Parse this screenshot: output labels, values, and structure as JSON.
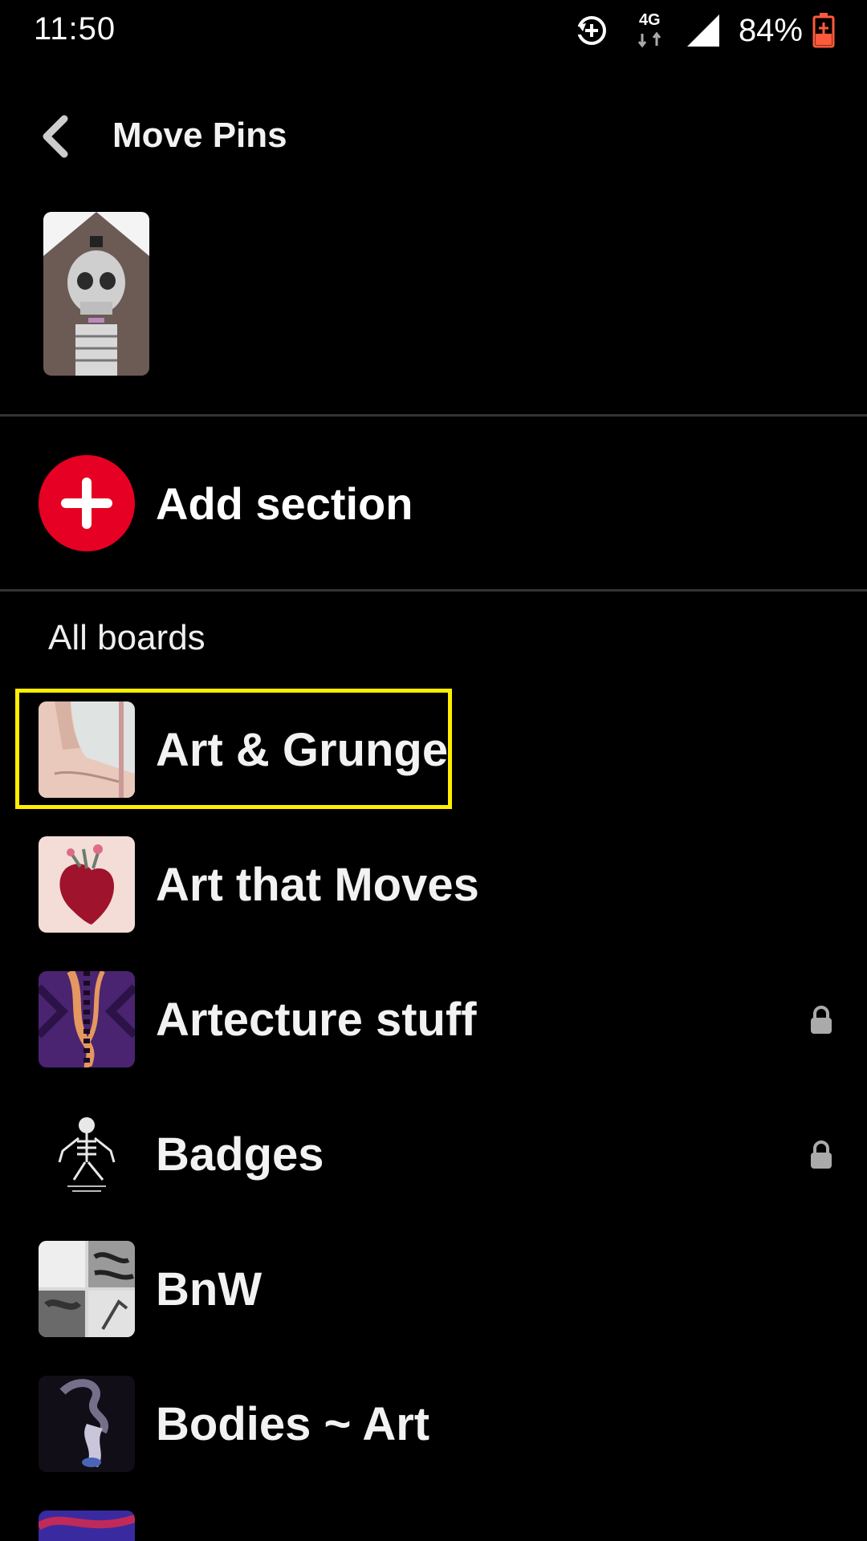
{
  "status_bar": {
    "time": "11:50",
    "network_label": "4G",
    "battery_percent": "84%",
    "icons": [
      "sync-icon",
      "network-4g-icon",
      "signal-icon",
      "battery-charging-icon"
    ]
  },
  "header": {
    "title": "Move Pins",
    "back_icon": "chevron-left-icon"
  },
  "pin": {
    "thumbnail": "skeleton-mural-image"
  },
  "add_section": {
    "label": "Add section",
    "icon": "plus-icon",
    "accent_color": "#e60023"
  },
  "boards_header": "All boards",
  "boards": [
    {
      "name": "Art & Grunge",
      "thumb": "neck-image",
      "locked": false,
      "highlighted": true
    },
    {
      "name": "Art that Moves",
      "thumb": "heart-image",
      "locked": false
    },
    {
      "name": "Artecture stuff",
      "thumb": "purple-pattern-image",
      "locked": true
    },
    {
      "name": "Badges",
      "thumb": "skeleton-sketch-image",
      "locked": true
    },
    {
      "name": "BnW",
      "thumb": "bw-collage-image",
      "locked": false
    },
    {
      "name": "Bodies ~ Art",
      "thumb": "smoke-figure-image",
      "locked": false
    }
  ],
  "colors": {
    "background": "#000000",
    "highlight": "#ffee00",
    "battery": "#ff5a3c"
  }
}
